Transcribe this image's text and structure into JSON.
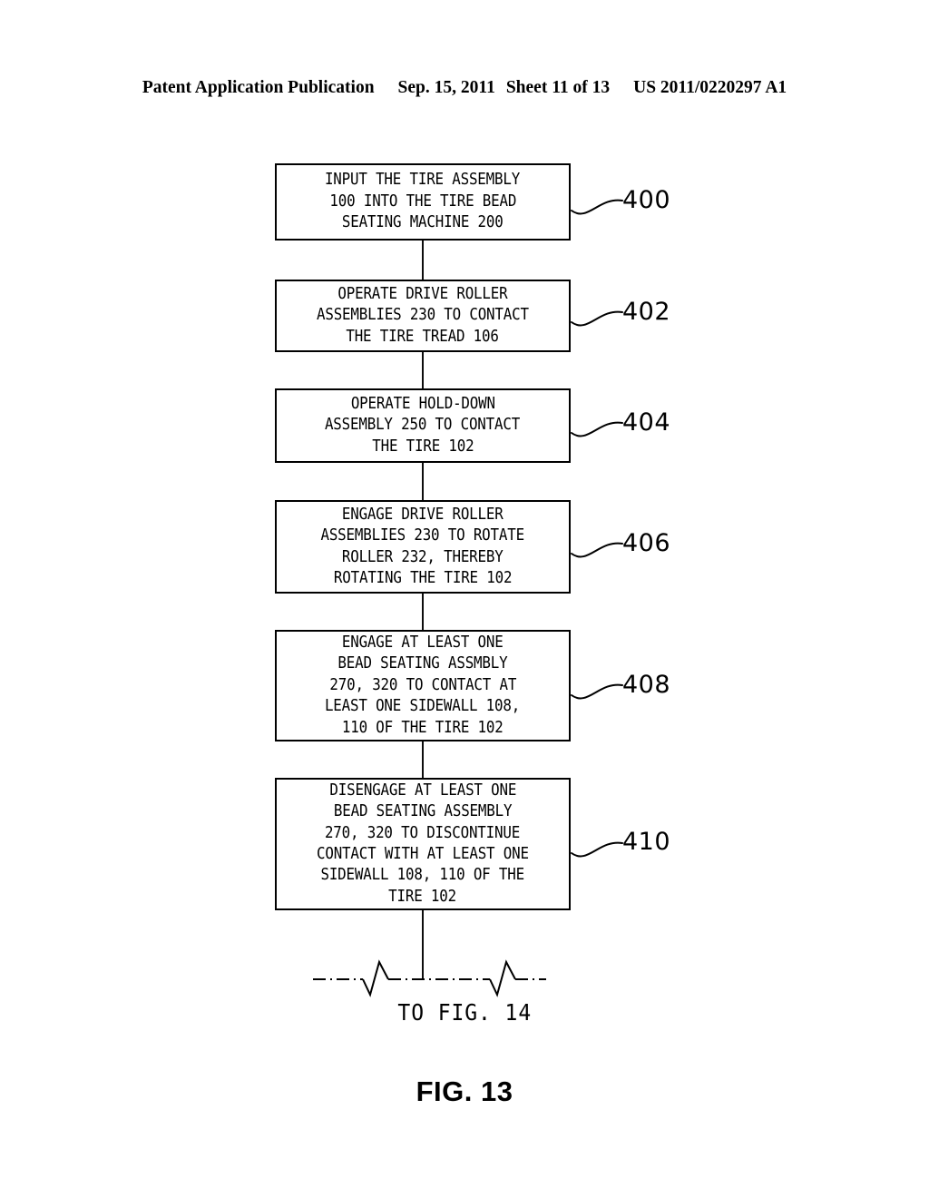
{
  "header": {
    "publication": "Patent Application Publication",
    "date": "Sep. 15, 2011",
    "sheet": "Sheet 11 of 13",
    "patent_number": "US 2011/0220297 A1"
  },
  "figure": {
    "caption": "FIG. 13",
    "continuation_label": "TO FIG. 14",
    "line_color": "#000000",
    "background_color": "#ffffff"
  },
  "flowchart": {
    "type": "process-flow",
    "orientation": "vertical",
    "steps": [
      {
        "ref": "400",
        "lines": [
          "INPUT THE TIRE ASSEMBLY",
          "100 INTO THE TIRE BEAD",
          "SEATING MACHINE 200"
        ]
      },
      {
        "ref": "402",
        "lines": [
          "OPERATE DRIVE ROLLER",
          "ASSEMBLIES 230 TO CONTACT",
          "THE TIRE TREAD 106"
        ]
      },
      {
        "ref": "404",
        "lines": [
          "OPERATE HOLD-DOWN",
          "ASSEMBLY 250 TO CONTACT",
          "THE TIRE 102"
        ]
      },
      {
        "ref": "406",
        "lines": [
          "ENGAGE DRIVE ROLLER",
          "ASSEMBLIES 230 TO ROTATE",
          "ROLLER 232, THEREBY",
          "ROTATING THE TIRE 102"
        ]
      },
      {
        "ref": "408",
        "lines": [
          "ENGAGE AT LEAST ONE",
          "BEAD SEATING ASSMBLY",
          "270, 320 TO CONTACT AT",
          "LEAST ONE SIDEWALL 108,",
          "110 OF THE TIRE 102"
        ]
      },
      {
        "ref": "410",
        "lines": [
          "DISENGAGE AT LEAST ONE",
          "BEAD SEATING ASSEMBLY",
          "270, 320 TO DISCONTINUE",
          "CONTACT WITH AT LEAST ONE",
          "SIDEWALL 108, 110 OF THE",
          "TIRE 102"
        ]
      }
    ]
  }
}
